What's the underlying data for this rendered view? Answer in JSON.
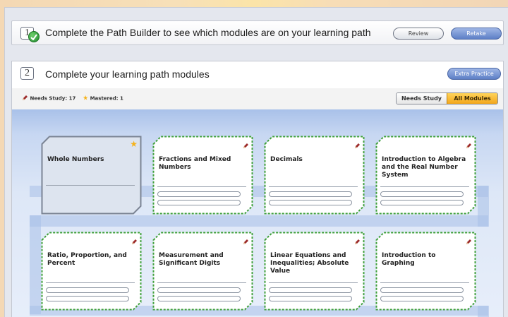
{
  "step1": {
    "number": "1",
    "title": "Complete the Path Builder to see which modules are on your learning path",
    "review_label": "Review",
    "retake_label": "Retake"
  },
  "step2": {
    "number": "2",
    "title": "Complete your learning path modules",
    "extra_practice_label": "Extra Practice",
    "needs_study_stat": "Needs Study: 17",
    "mastered_stat": "Mastered: 1",
    "filter": {
      "options": [
        "Needs Study",
        "All Modules"
      ],
      "selected": "All Modules"
    }
  },
  "modules": [
    {
      "name": "Whole Numbers",
      "status": "mastered"
    },
    {
      "name": "Fractions and Mixed Numbers",
      "status": "needs-study"
    },
    {
      "name": "Decimals",
      "status": "needs-study"
    },
    {
      "name": "Introduction to Algebra and the Real Number System",
      "status": "needs-study"
    },
    {
      "name": "Ratio, Proportion, and Percent",
      "status": "needs-study"
    },
    {
      "name": "Measurement and Significant Digits",
      "status": "needs-study"
    },
    {
      "name": "Linear Equations and Inequalities; Absolute Value",
      "status": "needs-study"
    },
    {
      "name": "Introduction to Graphing",
      "status": "needs-study"
    }
  ],
  "colors": {
    "accent_blue": "#5d7fc6",
    "mastered_fill": "#dde4ef",
    "needs_study_border": "#3fa03a",
    "star": "#f5b21a",
    "pencil": "#9c2a2a"
  }
}
